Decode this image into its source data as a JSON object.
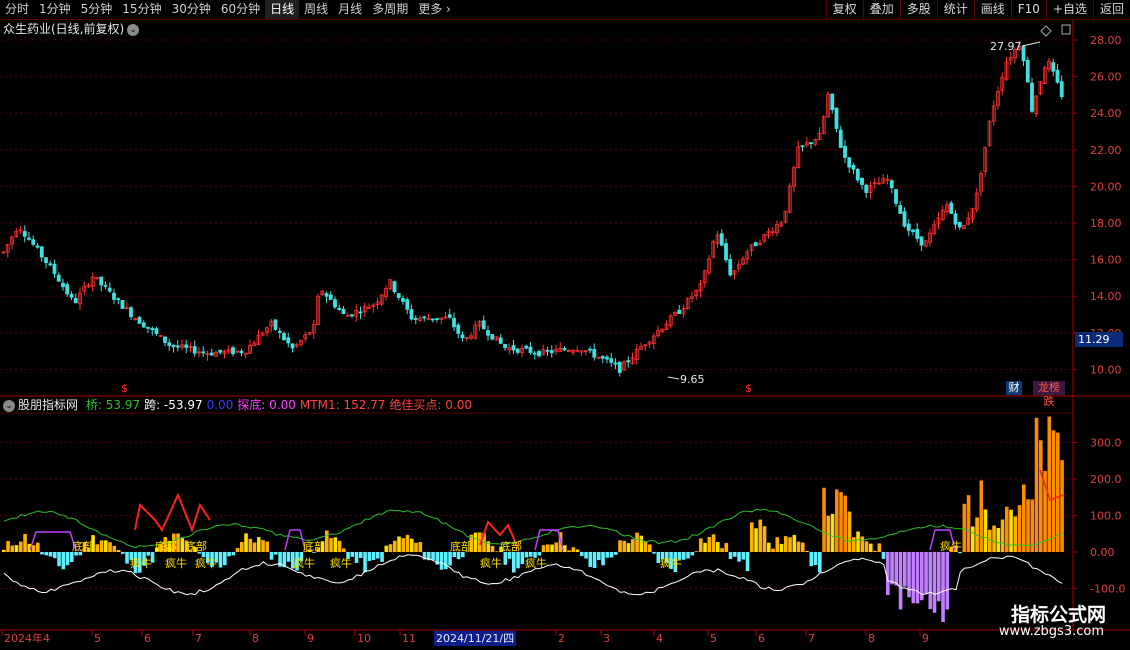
{
  "toolbar": {
    "periods": [
      "分时",
      "1分钟",
      "5分钟",
      "15分钟",
      "30分钟",
      "60分钟",
      "日线",
      "周线",
      "月线",
      "多周期",
      "更多"
    ],
    "active_period": "日线",
    "more_label": "更多",
    "right_buttons": [
      "复权",
      "叠加",
      "多股",
      "统计",
      "画线",
      "F10",
      "+自选",
      "返回"
    ]
  },
  "stock": {
    "title": "众生药业(日线,前复权)"
  },
  "price_axis": {
    "ticks": [
      "28.00",
      "26.00",
      "24.00",
      "22.00",
      "20.00",
      "18.00",
      "16.00",
      "14.00",
      "12.00",
      "10.00"
    ],
    "current": "11.29",
    "high_label": "27.97",
    "low_label": "9.65"
  },
  "badges": {
    "finance": "财",
    "dragon": "龙榜跌"
  },
  "indicator": {
    "name": "股朋指标网",
    "legend": [
      {
        "label": "桥: ",
        "value": "53.97",
        "color": "#2fbf2f"
      },
      {
        "label": "跨: ",
        "value": "-53.97",
        "color": "#ffffff"
      },
      {
        "label": "",
        "value": "0.00",
        "color": "#3c3cff"
      },
      {
        "label": "探底: ",
        "value": "0.00",
        "color": "#ff40ff"
      },
      {
        "label": "MTM1: ",
        "value": "152.77",
        "color": "#ff4040"
      },
      {
        "label": "绝佳买点: ",
        "value": "0.00",
        "color": "#ff4040"
      }
    ],
    "axis_ticks": [
      "300.0",
      "200.0",
      "100.0",
      "0.00",
      "-100.0"
    ],
    "signal_text": [
      "底部",
      "底部",
      "底部",
      "底部",
      "底部",
      "底部",
      "疯牛",
      "疯牛",
      "疯牛",
      "疯牛",
      "疯牛",
      "疯牛",
      "疯牛",
      "疯牛",
      "疯牛"
    ]
  },
  "time_axis": {
    "labels": [
      "2024年4",
      "5",
      "6",
      "7",
      "8",
      "9",
      "10",
      "11",
      "2",
      "3",
      "4",
      "5",
      "6",
      "7",
      "8",
      "9"
    ],
    "highlight": "2024/11/21/四"
  },
  "watermark": {
    "line1": "指标公式网",
    "line2": "www.zbgs3.com"
  },
  "colors": {
    "up": "#ff3030",
    "down": "#40e0e0",
    "grid": "#5a0000",
    "axis": "#b00000"
  }
}
